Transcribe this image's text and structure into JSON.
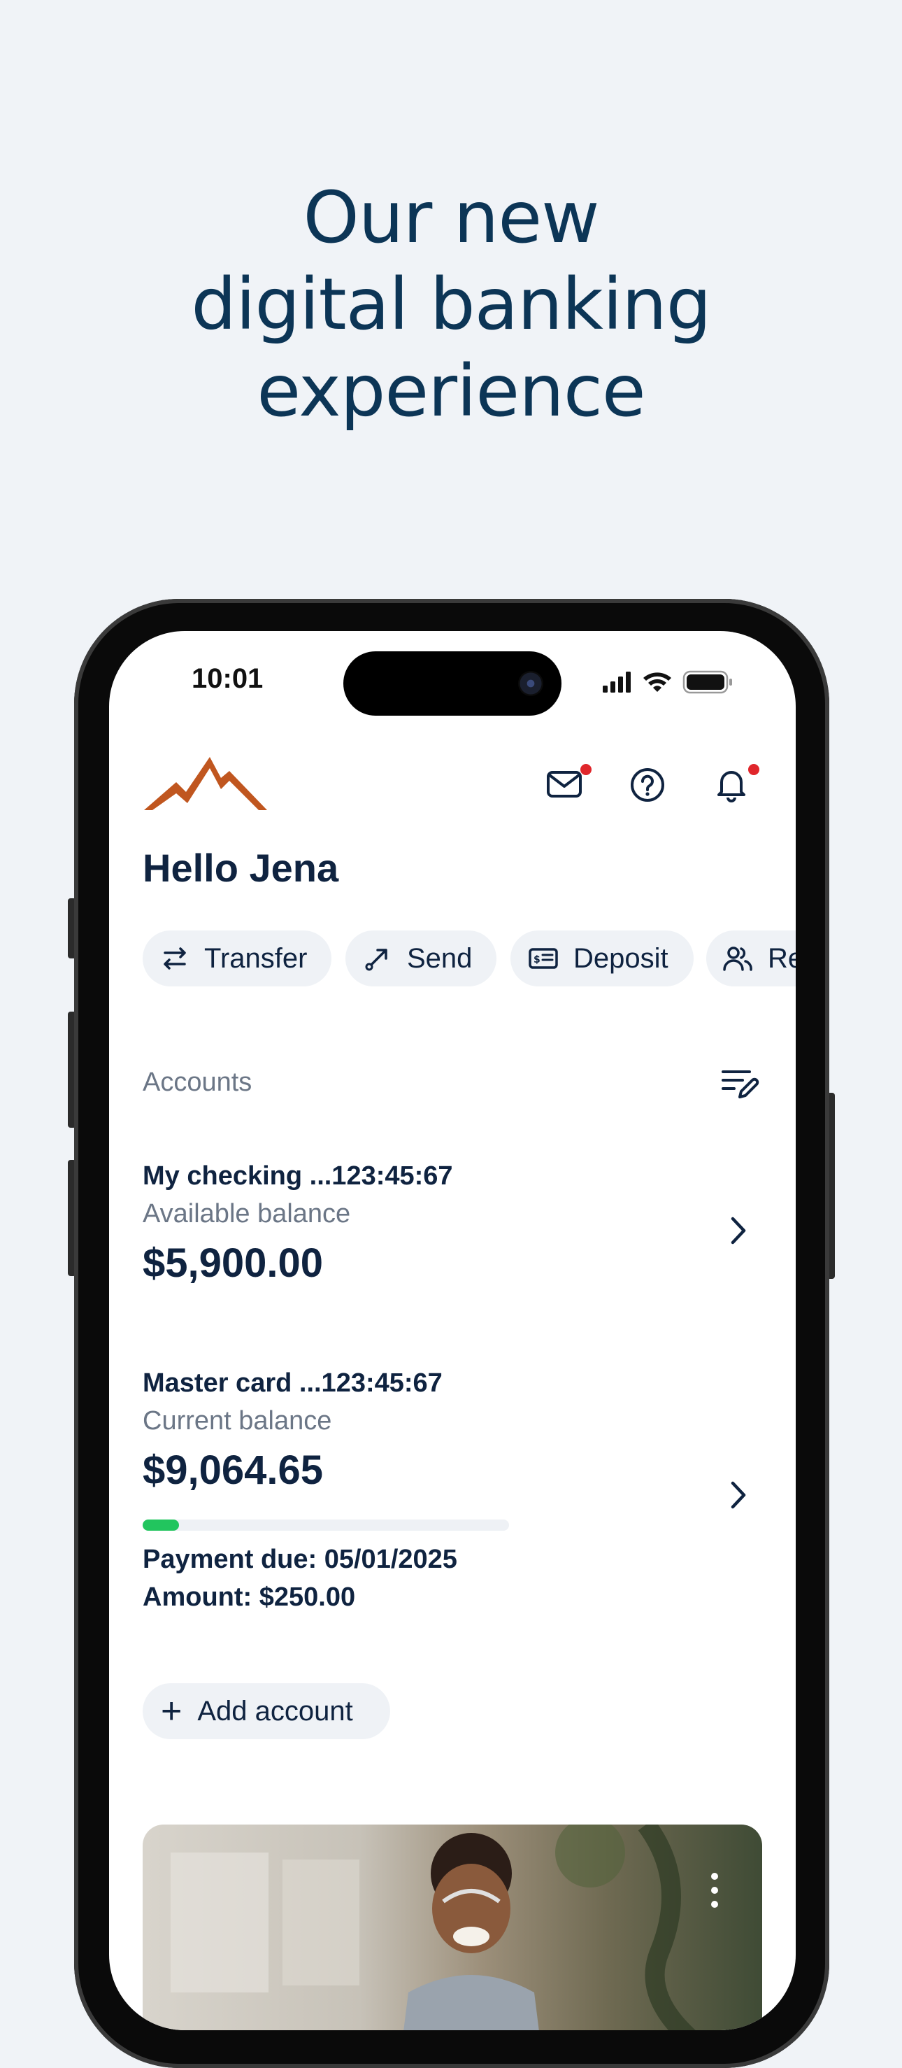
{
  "headline": {
    "line1": "Our new",
    "line2": "digital banking",
    "line3": "experience"
  },
  "status_bar": {
    "time": "10:01"
  },
  "header": {
    "logo": "mountain-logo",
    "icons": [
      "mail-icon",
      "help-icon",
      "bell-icon"
    ],
    "notification_color": "#e0262b"
  },
  "greeting": "Hello Jena",
  "quick_actions": [
    {
      "label": "Transfer",
      "icon": "transfer-icon"
    },
    {
      "label": "Send",
      "icon": "send-icon"
    },
    {
      "label": "Deposit",
      "icon": "deposit-icon"
    },
    {
      "label": "Re",
      "icon": "people-icon"
    }
  ],
  "accounts": {
    "title": "Accounts",
    "items": [
      {
        "name": "My checking ...123:45:67",
        "balance_label": "Available balance",
        "balance": "$5,900.00"
      },
      {
        "name": "Master card ...123:45:67",
        "balance_label": "Current balance",
        "balance": "$9,064.65",
        "progress_fraction": 0.1,
        "payment_due": "Payment due: 05/01/2025",
        "amount": "Amount: $250.00"
      }
    ],
    "add_label": "Add account"
  },
  "colors": {
    "brand_navy": "#0c3556",
    "logo_orange": "#c0561f",
    "progress_green": "#22c55e"
  }
}
